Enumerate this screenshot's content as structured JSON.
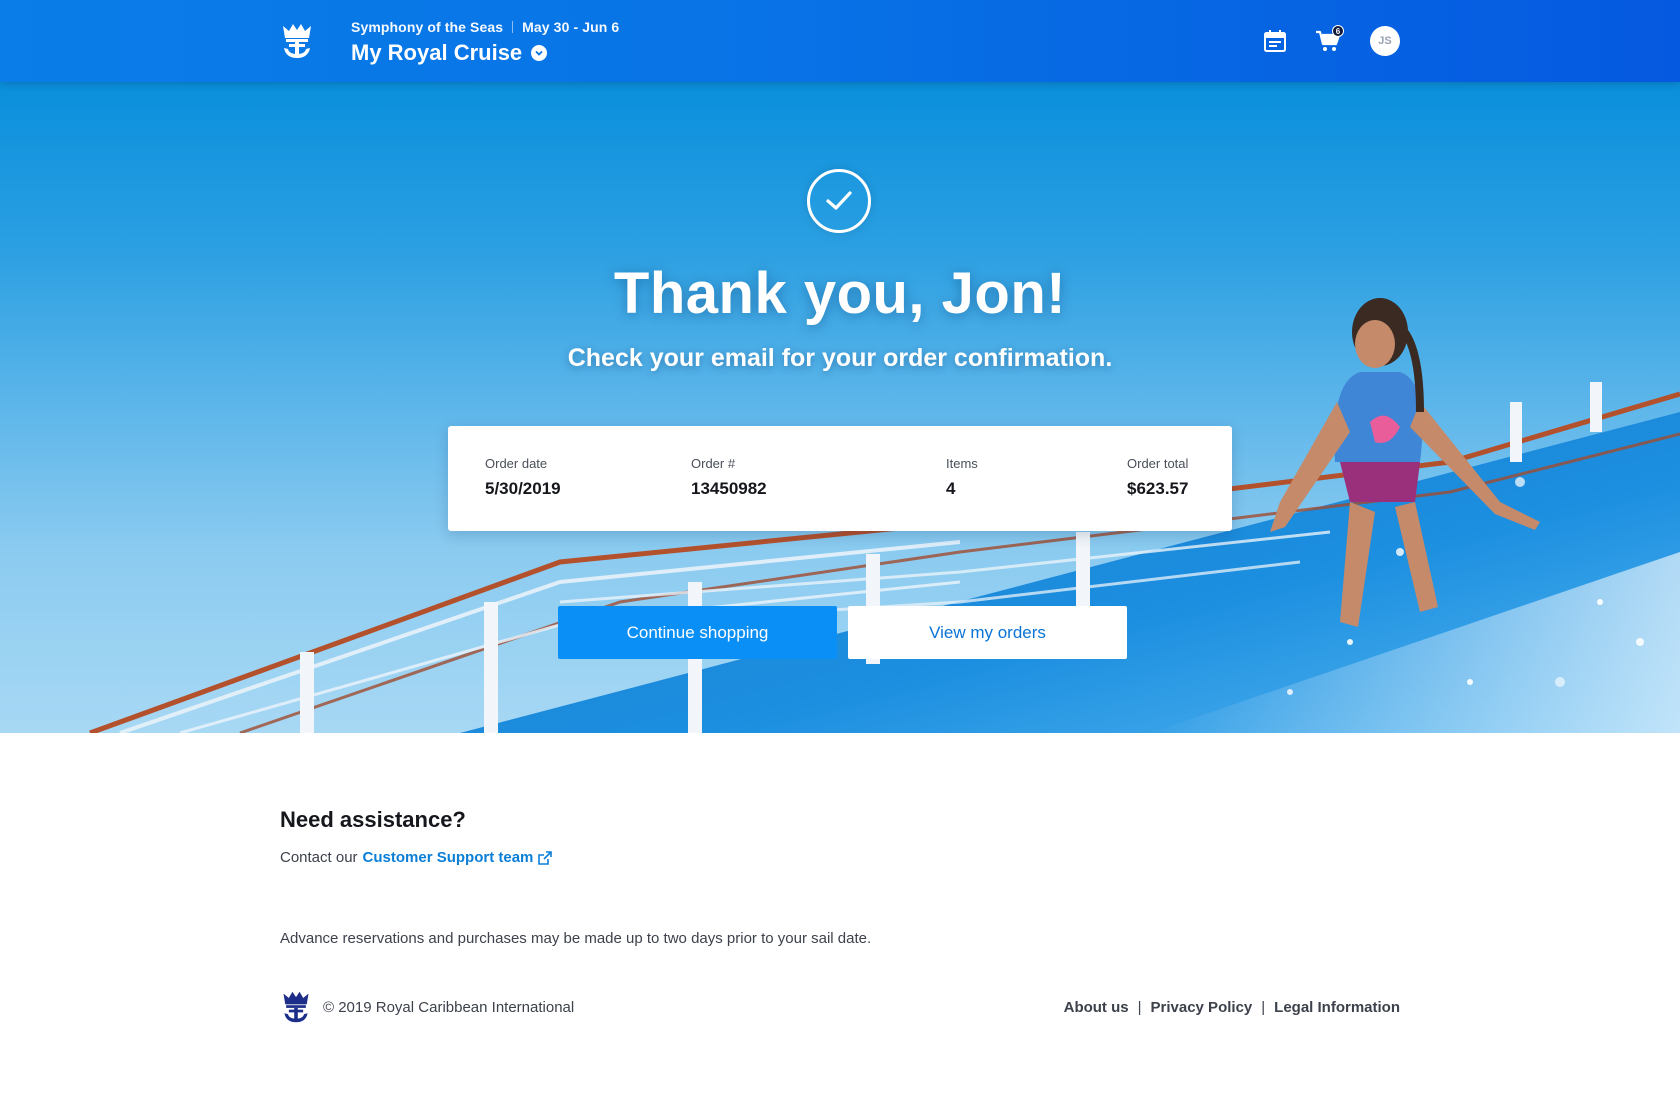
{
  "header": {
    "ship": "Symphony of the Seas",
    "dates": "May 30 - Jun 6",
    "title": "My Royal Cruise",
    "cart_count": "6",
    "avatar_initials": "JS",
    "icons": {
      "logo": "crown-anchor-logo-icon",
      "title_dropdown": "chevron-down-icon",
      "calendar": "calendar-icon",
      "cart": "shopping-cart-icon"
    }
  },
  "hero": {
    "heading": "Thank you, Jon!",
    "subheading": "Check your email for your order confirmation.",
    "check_icon": "checkmark-circle-icon"
  },
  "order": {
    "date_label": "Order date",
    "date_value": "5/30/2019",
    "number_label": "Order #",
    "number_value": "13450982",
    "items_label": "Items",
    "items_value": "4",
    "total_label": "Order total",
    "total_value": "$623.57"
  },
  "actions": {
    "continue_label": "Continue shopping",
    "orders_label": "View my orders"
  },
  "assistance": {
    "title": "Need assistance?",
    "prefix": "Contact our",
    "link_label": "Customer Support team",
    "link_icon": "external-link-icon"
  },
  "note": "Advance reservations and purchases may be made up to two days prior to your sail date.",
  "footer": {
    "copyright": "© 2019 Royal Caribbean International",
    "links": [
      "About us",
      "Privacy Policy",
      "Legal Information"
    ],
    "separator": "|"
  },
  "colors": {
    "header_blue": "#0873e6",
    "primary_button": "#0a8ff6",
    "link_blue": "#0b7fd8",
    "logo_navy": "#1c2d8a"
  }
}
